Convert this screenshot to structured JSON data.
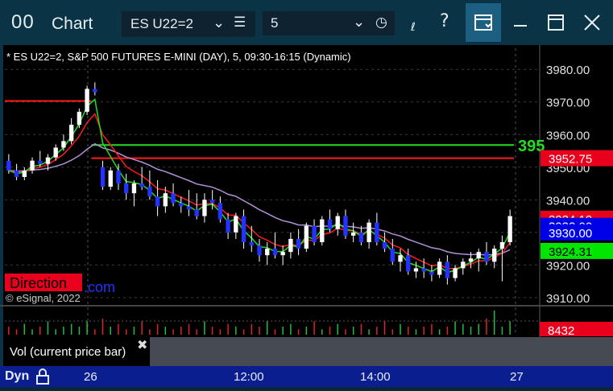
{
  "window": {
    "title_icon": "00",
    "title": "Chart",
    "symbol": "ES U22=2",
    "interval": "5",
    "icons": [
      "chevron-down-icon",
      "list-icon",
      "clock-icon",
      "draw-icon",
      "help-icon",
      "layout-icon",
      "minimize-icon",
      "maximize-icon",
      "close-icon"
    ]
  },
  "chart": {
    "header": "* ES U22=2, S&P 500 FUTURES E-MINI (DAY), 5, 09:30-16:15 (Dynamic)",
    "copyright": "© eSignal, 2022",
    "direction_label": "Direction",
    "com_text": ".com",
    "line_value_label": "395",
    "price_axis": {
      "ticks": [
        "3980.00",
        "3970.00",
        "3960.00",
        "3950.00",
        "3940.00",
        "3930.00",
        "3920.00",
        "3910.00"
      ],
      "badges": [
        {
          "text": "3952.75",
          "bg": "#e8001c"
        },
        {
          "text": "3934.19",
          "bg": "#e8001c"
        },
        {
          "text": "3932.00",
          "bg": "#0000e6"
        },
        {
          "text": "3930.00",
          "bg": "#0000e6"
        },
        {
          "text": "3924.31",
          "bg": "#00e600"
        }
      ]
    },
    "volume": {
      "label": "Vol (current price bar)",
      "badge": "8432",
      "badge_bg": "#e8001c"
    },
    "time_axis": {
      "mode": "Dyn",
      "ticks": [
        "26",
        "12:00",
        "14:00",
        "27"
      ]
    },
    "colors": {
      "up": "#ffffff",
      "down": "#2233ff",
      "red_line": "#ff1a1a",
      "green_line": "#22dd22",
      "purple_line": "#b090d8",
      "volume_up": "#22bb44",
      "volume_down": "#dd2222"
    }
  },
  "chart_data": {
    "type": "line",
    "y_range": [
      3908,
      3984
    ],
    "candles": [
      [
        3952,
        3954,
        3948,
        3949
      ],
      [
        3949,
        3951,
        3946,
        3947
      ],
      [
        3947,
        3950,
        3946,
        3949
      ],
      [
        3949,
        3953,
        3948,
        3952
      ],
      [
        3952,
        3955,
        3950,
        3951
      ],
      [
        3951,
        3954,
        3949,
        3953
      ],
      [
        3953,
        3957,
        3952,
        3956
      ],
      [
        3956,
        3960,
        3955,
        3958
      ],
      [
        3958,
        3965,
        3957,
        3963
      ],
      [
        3963,
        3968,
        3962,
        3967
      ],
      [
        3967,
        3975,
        3966,
        3974
      ],
      [
        3974,
        3976,
        3972,
        3973
      ],
      [
        3950,
        3952,
        3943,
        3944
      ],
      [
        3944,
        3950,
        3943,
        3949
      ],
      [
        3949,
        3951,
        3943,
        3945
      ],
      [
        3945,
        3948,
        3940,
        3942
      ],
      [
        3942,
        3946,
        3938,
        3945
      ],
      [
        3945,
        3950,
        3943,
        3944
      ],
      [
        3944,
        3949,
        3940,
        3941
      ],
      [
        3941,
        3946,
        3935,
        3938
      ],
      [
        3938,
        3944,
        3936,
        3942
      ],
      [
        3942,
        3945,
        3938,
        3939
      ],
      [
        3939,
        3941,
        3936,
        3938
      ],
      [
        3938,
        3943,
        3935,
        3937
      ],
      [
        3937,
        3942,
        3934,
        3935
      ],
      [
        3935,
        3942,
        3933,
        3940
      ],
      [
        3940,
        3943,
        3937,
        3939
      ],
      [
        3939,
        3941,
        3933,
        3934
      ],
      [
        3934,
        3936,
        3928,
        3930
      ],
      [
        3930,
        3936,
        3928,
        3935
      ],
      [
        3935,
        3937,
        3925,
        3927
      ],
      [
        3927,
        3932,
        3924,
        3926
      ],
      [
        3926,
        3928,
        3921,
        3923
      ],
      [
        3923,
        3927,
        3920,
        3925
      ],
      [
        3925,
        3930,
        3922,
        3923
      ],
      [
        3923,
        3926,
        3920,
        3924
      ],
      [
        3924,
        3930,
        3922,
        3928
      ],
      [
        3928,
        3931,
        3923,
        3925
      ],
      [
        3925,
        3933,
        3924,
        3932
      ],
      [
        3932,
        3934,
        3926,
        3927
      ],
      [
        3927,
        3935,
        3926,
        3934
      ],
      [
        3934,
        3937,
        3930,
        3931
      ],
      [
        3931,
        3936,
        3929,
        3935
      ],
      [
        3935,
        3937,
        3928,
        3929
      ],
      [
        3929,
        3933,
        3927,
        3930
      ],
      [
        3930,
        3932,
        3926,
        3927
      ],
      [
        3927,
        3934,
        3925,
        3933
      ],
      [
        3933,
        3936,
        3926,
        3927
      ],
      [
        3927,
        3930,
        3924,
        3925
      ],
      [
        3925,
        3928,
        3920,
        3921
      ],
      [
        3921,
        3925,
        3918,
        3923
      ],
      [
        3923,
        3925,
        3917,
        3918
      ],
      [
        3918,
        3921,
        3916,
        3919
      ],
      [
        3919,
        3922,
        3916,
        3918
      ],
      [
        3918,
        3920,
        3915,
        3917
      ],
      [
        3917,
        3922,
        3916,
        3921
      ],
      [
        3921,
        3923,
        3914,
        3916
      ],
      [
        3916,
        3920,
        3915,
        3919
      ],
      [
        3919,
        3922,
        3917,
        3921
      ],
      [
        3921,
        3924,
        3919,
        3922
      ],
      [
        3922,
        3925,
        3918,
        3924
      ],
      [
        3924,
        3927,
        3920,
        3921
      ],
      [
        3921,
        3926,
        3919,
        3925
      ],
      [
        3925,
        3929,
        3915,
        3927
      ],
      [
        3927,
        3937,
        3926,
        3935
      ]
    ],
    "horizontal_lines": [
      {
        "name": "green",
        "value": 3956.8,
        "from": 0.17
      },
      {
        "name": "red",
        "value": 3952.75,
        "from": 0.17
      },
      {
        "name": "red",
        "value": 3970.3,
        "from": 0.0,
        "to": 0.17
      }
    ],
    "volume": [
      3,
      2,
      4,
      2,
      3,
      5,
      2,
      3,
      4,
      3,
      5,
      2,
      6,
      3,
      4,
      2,
      3,
      5,
      2,
      4,
      3,
      2,
      3,
      4,
      2,
      5,
      3,
      2,
      4,
      3,
      2,
      4,
      3,
      5,
      2,
      3,
      4,
      2,
      3,
      5,
      2,
      3,
      4,
      2,
      3,
      4,
      2,
      3,
      5,
      2,
      4,
      3,
      2,
      3,
      4,
      2,
      3,
      5,
      4,
      3,
      4,
      6,
      9,
      3,
      5
    ]
  }
}
